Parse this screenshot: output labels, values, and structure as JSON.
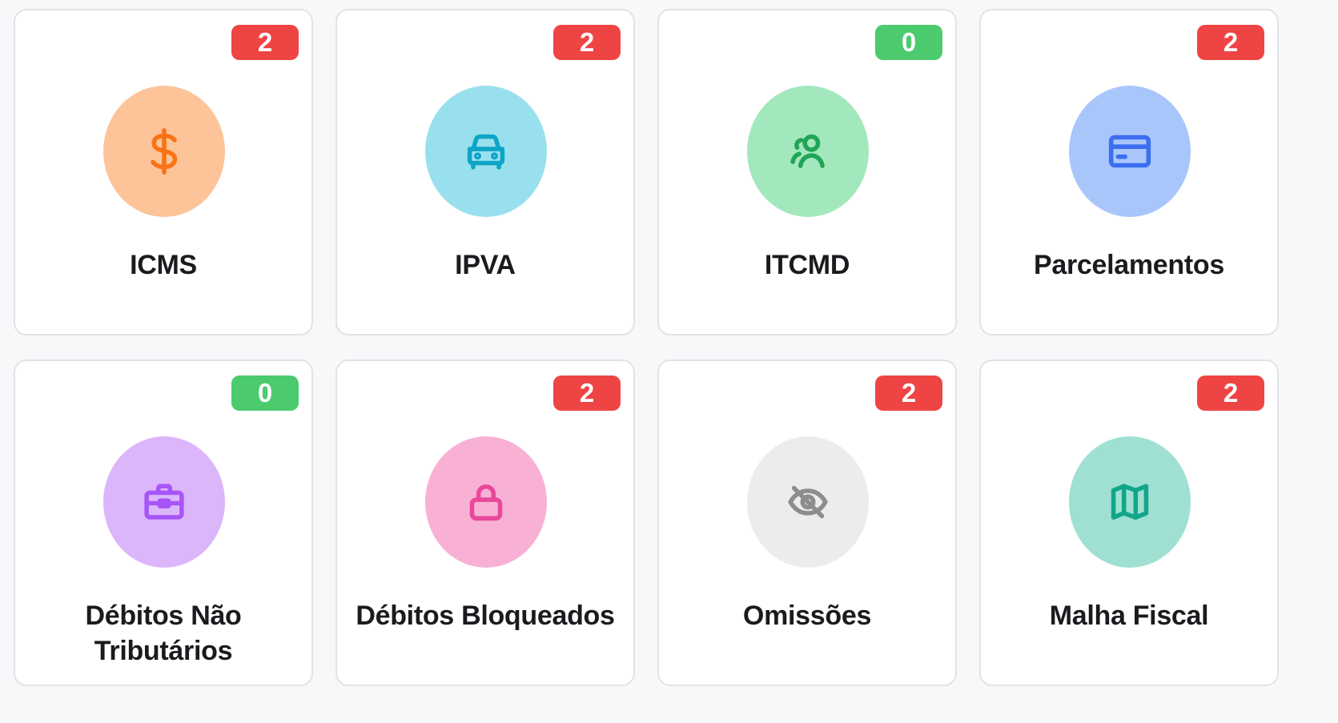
{
  "cards": [
    {
      "label": "ICMS",
      "badge": "2",
      "badge_color": "#ef4444",
      "icon": "dollar-icon",
      "circle_color": "#fdc49a",
      "icon_color": "#f97316"
    },
    {
      "label": "IPVA",
      "badge": "2",
      "badge_color": "#ef4444",
      "icon": "car-icon",
      "circle_color": "#99e0ee",
      "icon_color": "#0ea5c6"
    },
    {
      "label": "ITCMD",
      "badge": "0",
      "badge_color": "#4ccb6e",
      "icon": "users-icon",
      "circle_color": "#a3e8bd",
      "icon_color": "#22a457"
    },
    {
      "label": "Parcelamentos",
      "badge": "2",
      "badge_color": "#ef4444",
      "icon": "credit-card-icon",
      "circle_color": "#a9c6fb",
      "icon_color": "#3b6ef0"
    },
    {
      "label": "Débitos Não Tributários",
      "badge": "0",
      "badge_color": "#4ccb6e",
      "icon": "briefcase-icon",
      "circle_color": "#dbb6fb",
      "icon_color": "#a855f7"
    },
    {
      "label": "Débitos Bloqueados",
      "badge": "2",
      "badge_color": "#ef4444",
      "icon": "lock-icon",
      "circle_color": "#f8b1d5",
      "icon_color": "#e8479a"
    },
    {
      "label": "Omissões",
      "badge": "2",
      "badge_color": "#ef4444",
      "icon": "eye-off-icon",
      "circle_color": "#ececec",
      "icon_color": "#8d8d8d"
    },
    {
      "label": "Malha Fiscal",
      "badge": "2",
      "badge_color": "#ef4444",
      "icon": "map-icon",
      "circle_color": "#9fe0d2",
      "icon_color": "#12a58a"
    }
  ]
}
